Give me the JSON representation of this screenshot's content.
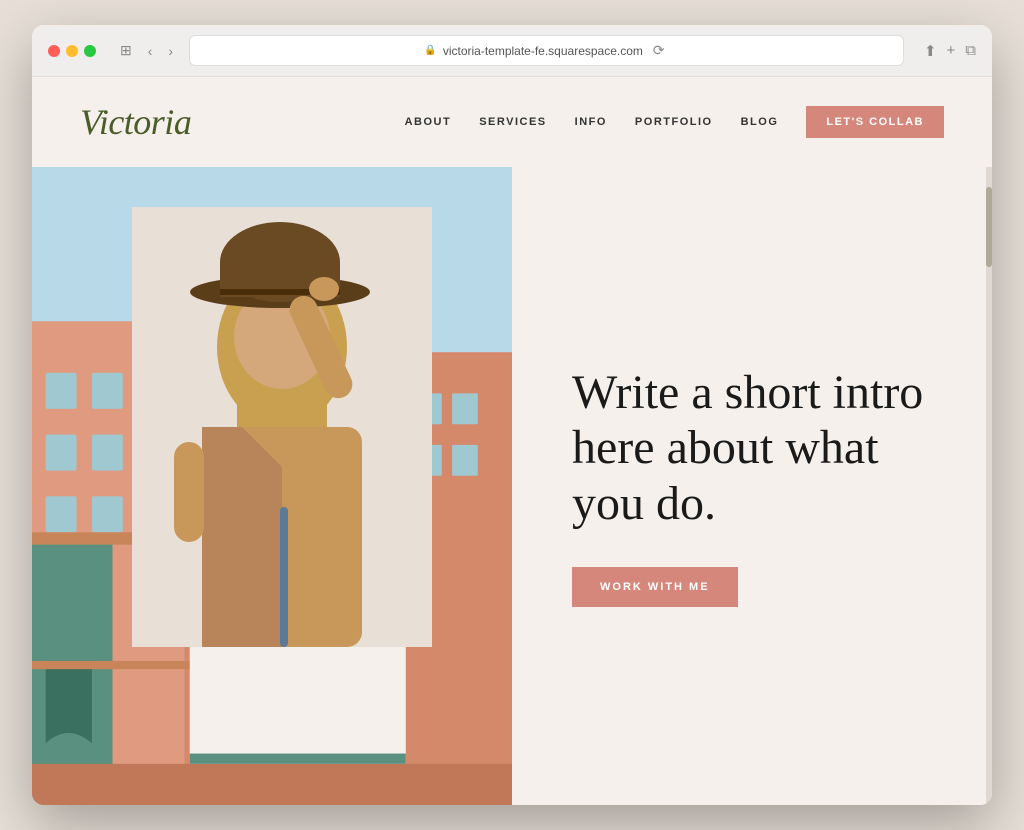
{
  "browser": {
    "url": "victoria-template-fe.squarespace.com",
    "reload_label": "⟳"
  },
  "site": {
    "logo": "Victoria",
    "nav": {
      "items": [
        {
          "label": "ABOUT",
          "id": "about"
        },
        {
          "label": "SERVICES",
          "id": "services"
        },
        {
          "label": "INFO",
          "id": "info"
        },
        {
          "label": "PORTFOLIO",
          "id": "portfolio"
        },
        {
          "label": "BLOG",
          "id": "blog"
        }
      ],
      "cta_label": "LET'S COLLAB"
    },
    "hero": {
      "headline": "Write a short intro here about what you do.",
      "cta_label": "WORK WITH ME"
    }
  },
  "colors": {
    "logo": "#4a5c2a",
    "cta_bg": "#d4877a",
    "nav_text": "#333333",
    "hero_bg": "#f5f0eb",
    "headline_color": "#1a1a1a"
  }
}
